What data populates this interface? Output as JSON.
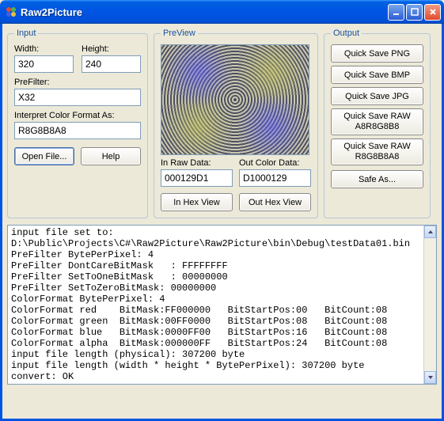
{
  "window": {
    "title": "Raw2Picture"
  },
  "input": {
    "legend": "Input",
    "width_label": "Width:",
    "width_value": "320",
    "height_label": "Height:",
    "height_value": "240",
    "prefilter_label": "PreFilter:",
    "prefilter_value": "X32",
    "interpret_label": "Interpret Color Format As:",
    "interpret_value": "R8G8B8A8",
    "open_file": "Open File...",
    "help": "Help"
  },
  "preview": {
    "legend": "PreView",
    "in_raw_label": "In Raw Data:",
    "in_raw_value": "000129D1",
    "out_color_label": "Out Color Data:",
    "out_color_value": "D1000129",
    "in_hex": "In Hex View",
    "out_hex": "Out Hex View"
  },
  "output": {
    "legend": "Output",
    "quick_png": "Quick Save PNG",
    "quick_bmp": "Quick Save BMP",
    "quick_jpg": "Quick Save JPG",
    "quick_raw1_line1": "Quick Save RAW",
    "quick_raw1_line2": "A8R8G8B8",
    "quick_raw2_line1": "Quick Save RAW",
    "quick_raw2_line2": "R8G8B8A8",
    "safe_as": "Safe As..."
  },
  "log": "input file set to:\nD:\\Public\\Projects\\C#\\Raw2Picture\\Raw2Picture\\bin\\Debug\\testData01.bin\nPreFilter BytePerPixel: 4\nPreFilter DontCareBitMask   : FFFFFFFF\nPreFilter SetToOneBitMask   : 00000000\nPreFilter SetToZeroBitMask: 00000000\nColorFormat BytePerPixel: 4\nColorFormat red    BitMask:FF000000   BitStartPos:00   BitCount:08\nColorFormat green  BitMask:00FF0000   BitStartPos:08   BitCount:08\nColorFormat blue   BitMask:0000FF00   BitStartPos:16   BitCount:08\nColorFormat alpha  BitMask:000000FF   BitStartPos:24   BitCount:08\ninput file length (physical): 307200 byte\ninput file length (width * height * BytePerPixel): 307200 byte\nconvert: OK"
}
